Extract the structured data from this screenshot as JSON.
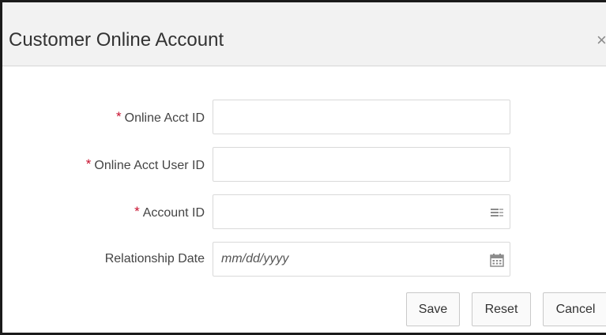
{
  "dialog": {
    "title": "Customer Online Account",
    "close_label": "×"
  },
  "form": {
    "fields": [
      {
        "label": "Online Acct ID",
        "required": true,
        "value": "",
        "placeholder": ""
      },
      {
        "label": "Online Acct User ID",
        "required": true,
        "value": "",
        "placeholder": ""
      },
      {
        "label": "Account ID",
        "required": true,
        "value": "",
        "placeholder": "",
        "icon": "list-lookup-icon"
      },
      {
        "label": "Relationship Date",
        "required": false,
        "value": "",
        "placeholder": "mm/dd/yyyy",
        "icon": "calendar-icon"
      }
    ],
    "required_marker": "*"
  },
  "buttons": {
    "save": "Save",
    "reset": "Reset",
    "cancel": "Cancel"
  },
  "colors": {
    "header_bg": "#f2f2f2",
    "required": "#c8102e",
    "border": "#d9d9d9",
    "icon": "#8c8c8c"
  }
}
